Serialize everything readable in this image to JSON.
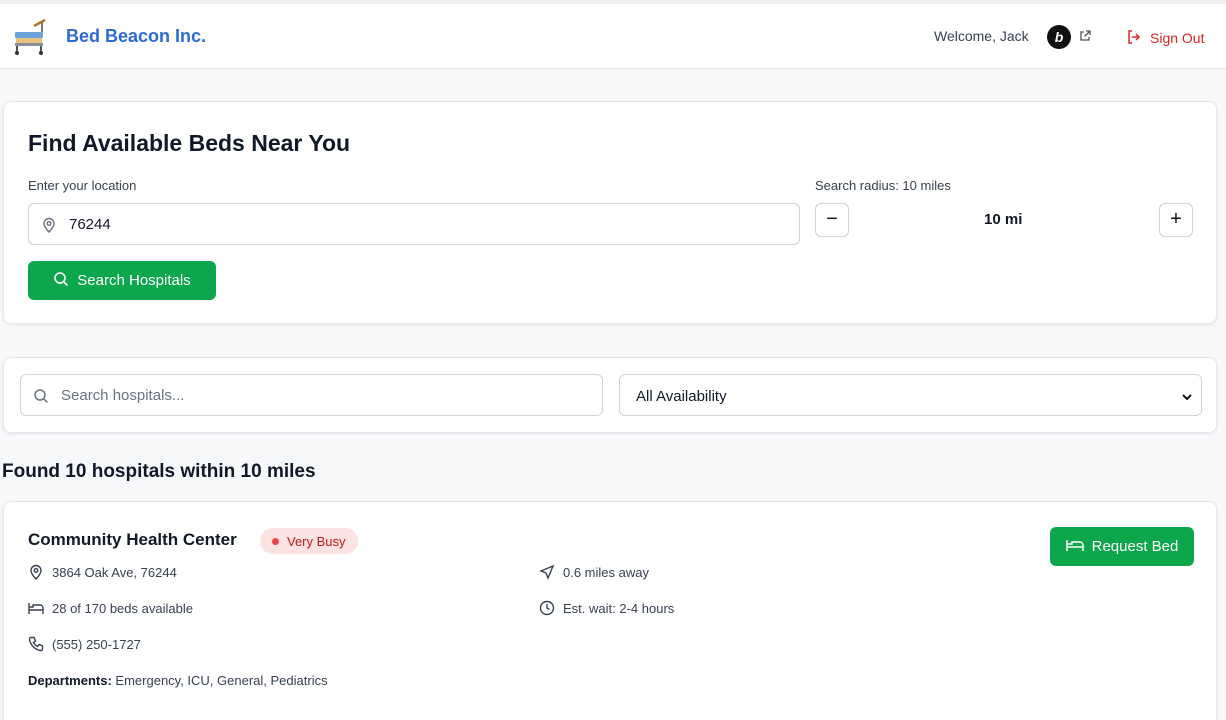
{
  "header": {
    "brand": "Bed Beacon Inc.",
    "welcome": "Welcome, Jack",
    "bicon_letter": "b",
    "sign_out": "Sign Out"
  },
  "search": {
    "title": "Find Available Beds Near You",
    "location_label": "Enter your location",
    "location_value": "76244",
    "radius_label": "Search radius: 10 miles",
    "radius_value": "10 mi",
    "decrease_symbol": "−",
    "increase_symbol": "+",
    "search_button": "Search Hospitals"
  },
  "filter": {
    "search_placeholder": "Search hospitals...",
    "availability_selected": "All Availability"
  },
  "results": {
    "summary": "Found 10 hospitals within 10 miles",
    "hospitals": [
      {
        "name": "Community Health Center",
        "status": "Very Busy",
        "address": "3864 Oak Ave, 76244",
        "distance": "0.6 miles away",
        "beds": "28 of 170 beds available",
        "wait": "Est. wait: 2-4 hours",
        "phone": "(555) 250-1727",
        "departments_label": "Departments:",
        "departments": "Emergency, ICU, General, Pediatrics",
        "request_button": "Request Bed"
      }
    ]
  },
  "colors": {
    "brand": "#2e6bd6",
    "primary_green": "#0ca64c",
    "danger": "#dc2626",
    "busy_badge_bg": "#fde2e2"
  },
  "icons": [
    "hospital-bed-logo",
    "external-link-icon",
    "sign-out-icon",
    "map-pin-icon",
    "search-icon",
    "chevron-down-icon",
    "navigation-icon",
    "bed-icon",
    "clock-icon",
    "phone-icon"
  ]
}
